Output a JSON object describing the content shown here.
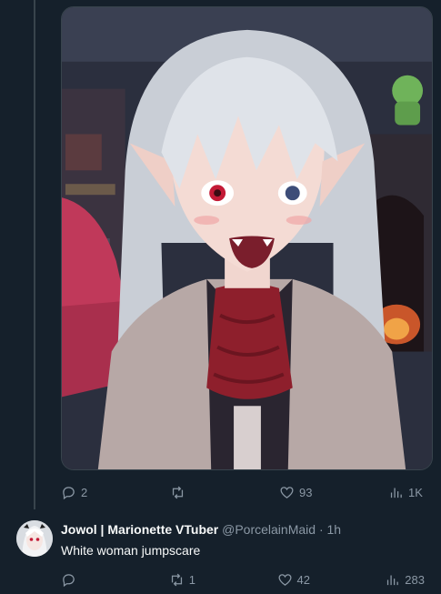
{
  "colors": {
    "background": "#15202b",
    "secondary_text": "#8b98a5",
    "primary_text": "#f7f9f9",
    "thread_line": "#38444d"
  },
  "post1": {
    "media_icon": "anime-character-image",
    "actions": {
      "reply_count": "2",
      "retweet_count": "",
      "like_count": "93",
      "views_count": "1K"
    }
  },
  "post2": {
    "display_name": "Jowol | Marionette VTuber",
    "handle": "@PorcelainMaid",
    "separator": "·",
    "time": "1h",
    "text": "White woman jumpscare",
    "actions": {
      "reply_count": "",
      "retweet_count": "1",
      "like_count": "42",
      "views_count": "283"
    }
  }
}
